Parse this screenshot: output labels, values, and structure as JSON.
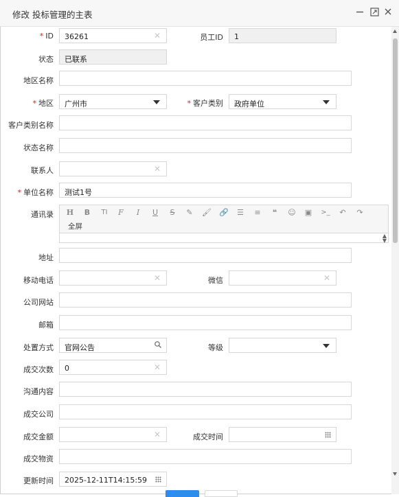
{
  "dialog": {
    "title": "修改 投标管理的主表"
  },
  "icons": {
    "minimize": "minimize-icon",
    "maximize": "maximize-icon",
    "close": "close-icon"
  },
  "form": {
    "id": {
      "label": "ID",
      "value": "36261"
    },
    "employee_id": {
      "label": "员工ID",
      "value": "1"
    },
    "status": {
      "label": "状态",
      "value": "已联系"
    },
    "region_name": {
      "label": "地区名称",
      "value": ""
    },
    "region": {
      "label": "地区",
      "value": "广州市"
    },
    "customer_type": {
      "label": "客户类别",
      "value": "政府单位"
    },
    "customer_type_name": {
      "label": "客户类别名称",
      "value": ""
    },
    "status_name": {
      "label": "状态名称",
      "value": ""
    },
    "contact": {
      "label": "联系人",
      "value": ""
    },
    "company_name": {
      "label": "单位名称",
      "value": "测试1号"
    },
    "address_book": {
      "label": "通讯录",
      "fullscreen_label": "全屏"
    },
    "address": {
      "label": "地址",
      "value": ""
    },
    "mobile": {
      "label": "移动电话",
      "value": ""
    },
    "wechat": {
      "label": "微信",
      "value": ""
    },
    "website": {
      "label": "公司网站",
      "value": ""
    },
    "email": {
      "label": "邮箱",
      "value": ""
    },
    "handling": {
      "label": "处置方式",
      "value": "官网公告"
    },
    "level": {
      "label": "等级",
      "value": ""
    },
    "deal_count": {
      "label": "成交次数",
      "value": "0"
    },
    "communication": {
      "label": "沟通内容",
      "value": ""
    },
    "deal_company": {
      "label": "成交公司",
      "value": ""
    },
    "deal_amount": {
      "label": "成交金额",
      "value": ""
    },
    "deal_time": {
      "label": "成交时间",
      "value": ""
    },
    "deal_goods": {
      "label": "成交物资",
      "value": ""
    },
    "update_time": {
      "label": "更新时间",
      "value": "2025-12-11T14:15:59"
    }
  },
  "colors": {
    "required": "#e02020",
    "primary_button": "#2d8cf0"
  }
}
